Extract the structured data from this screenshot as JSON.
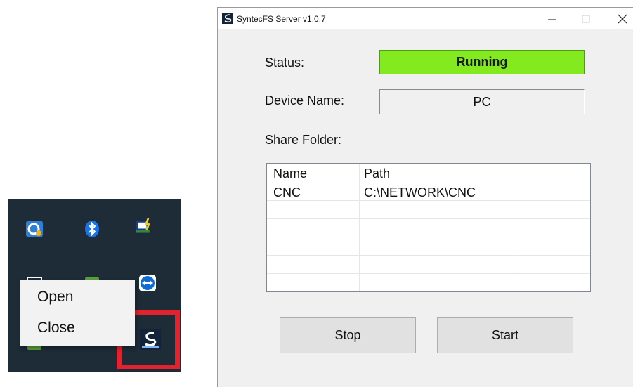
{
  "menu": {
    "open_label": "Open",
    "close_label": "Close"
  },
  "tray": {
    "icons": [
      "cloud-sync-icon",
      "bluetooth-icon",
      "power-app-icon",
      "monitor-icon",
      "battery-icon",
      "teamviewer-icon",
      "network-icon",
      "syntec-tray-icon"
    ]
  },
  "window": {
    "title": "SyntecFS Server v1.0.7",
    "status_label": "Status:",
    "status_value": "Running",
    "status_color": "#83ea20",
    "device_label": "Device Name:",
    "device_value": "PC",
    "share_label": "Share Folder:",
    "table": {
      "headers": [
        "Name",
        "Path"
      ],
      "rows": [
        [
          "CNC",
          "C:\\NETWORK\\CNC"
        ]
      ]
    },
    "stop_label": "Stop",
    "start_label": "Start"
  },
  "colors": {
    "highlight": "#e3222e",
    "tray_background": "#1e2c38"
  }
}
